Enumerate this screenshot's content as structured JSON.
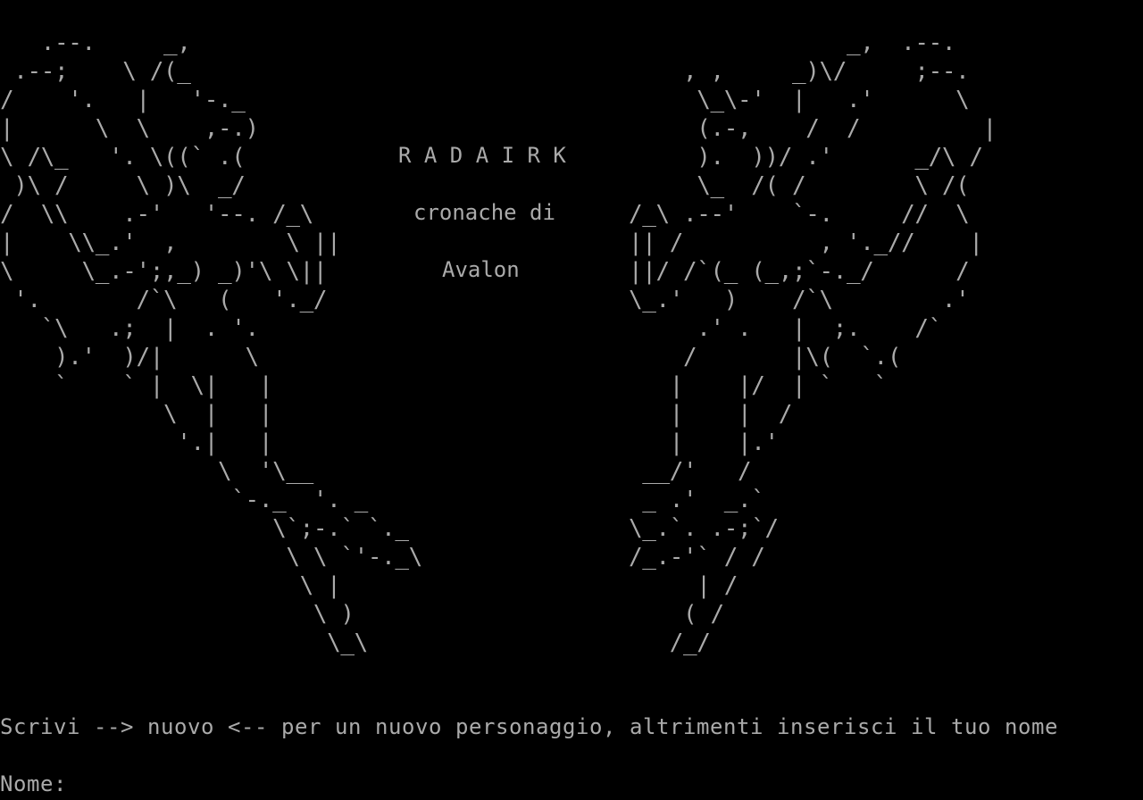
{
  "screen": {
    "background": "#000000",
    "foreground": "#aaaaaa"
  },
  "banner": {
    "art_left": "   .--.     _,\n .--;    \\ /(_\n/    '.   |   '-._\n|      \\  \\    ,-.)\n\\ /\\_   '. \\((` .(\n )\\ /     \\ )\\  _/\n/  \\\\    .-'   '--. /_\\\n|    \\\\_.'  ,        \\ ||\n\\     \\_.-';,_) _)'\\ \\||\n '.       /`\\   (   '._/\n   `\\   .;  |  . '.\n    ).'  )/|      \\\n    `    ` |  \\|   |\n            \\  |   |\n             '.|   |\n                \\  '\\__\n                 `-._  '. _\n                    \\`;-.` `._\n                     \\ \\ `'-._\\\n                      \\ |\n                       \\ )\n                        \\_\\",
    "art_right": "                _,  .--.\n    , ,     _)\\/     ;--.\n     \\_\\-'  |   .'      \\\n     (.-,    /  /         |\n     ).  ))/ .'      _/\\ /\n     \\_  /( /        \\ /(\n/_\\ .--'    `-.     //  \\\n|| /          , '._//    |\n||/ /`(_ (_,;`-._/      /\n\\_.'   )    /`\\        .'\n     .' .   |  ;.    /`\n    /       |\\(  `.(\n   |    |/  | `   `\n   |    |  /\n   |    |.'\n __/'   /\n _ .'  _.`\n\\_.`. .-;`/\n/_.-'` / /\n     | /\n    ( /\n   /_/",
    "title": "R A D A I R K",
    "subtitle_line1": "cronache di",
    "subtitle_line2": "Avalon"
  },
  "console": {
    "instruction": "Scrivi --> nuovo <-- per un nuovo personaggio, altrimenti inserisci il tuo nome",
    "prompt_label": "Nome:",
    "input_value": ""
  }
}
